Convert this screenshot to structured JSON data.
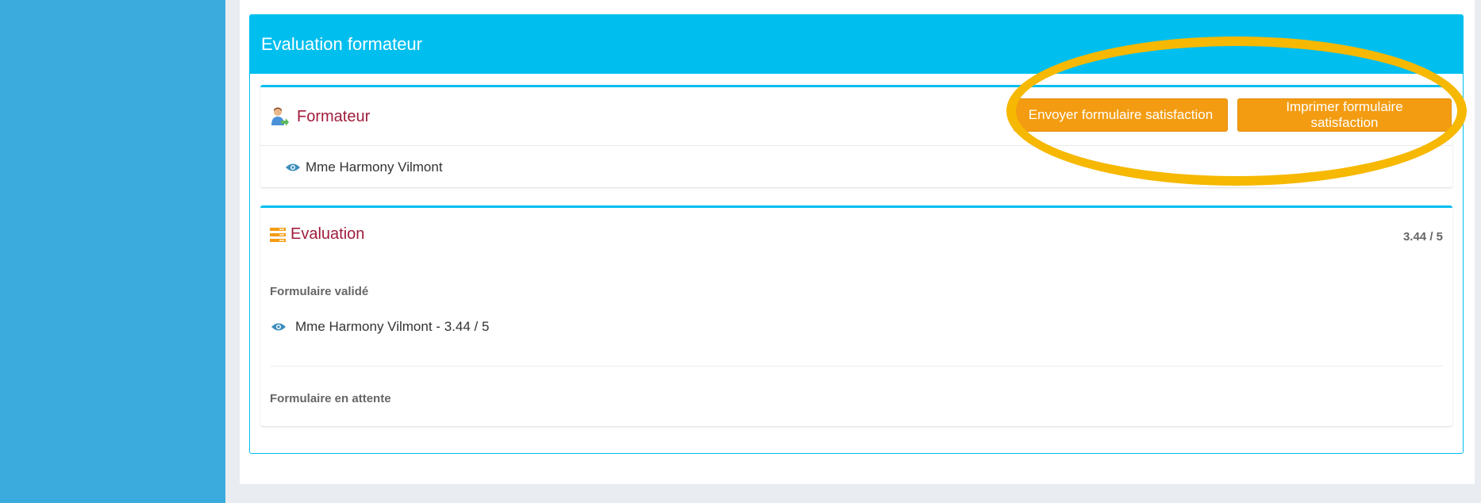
{
  "panel": {
    "title": "Evaluation formateur"
  },
  "formateur_box": {
    "title": "Formateur",
    "send_button": "Envoyer formulaire satisfaction",
    "print_button": "Imprimer formulaire satisfaction",
    "person": "Mme Harmony Vilmont"
  },
  "evaluation_box": {
    "title": "Evaluation",
    "score": "3.44 / 5",
    "validated_label": "Formulaire validé",
    "validated_person": "Mme Harmony Vilmont",
    "validated_separator": " - ",
    "validated_score": "3.44 / 5",
    "pending_label": "Formulaire en attente"
  },
  "colors": {
    "sidebar": "#3aabdc",
    "accent": "#00bfef",
    "title_red": "#a01d3c",
    "button_orange": "#f39c12",
    "highlight_yellow": "#f6b800"
  },
  "icons": {
    "formateur": "user-icon",
    "evaluation": "list-icon",
    "view": "eye-icon"
  }
}
